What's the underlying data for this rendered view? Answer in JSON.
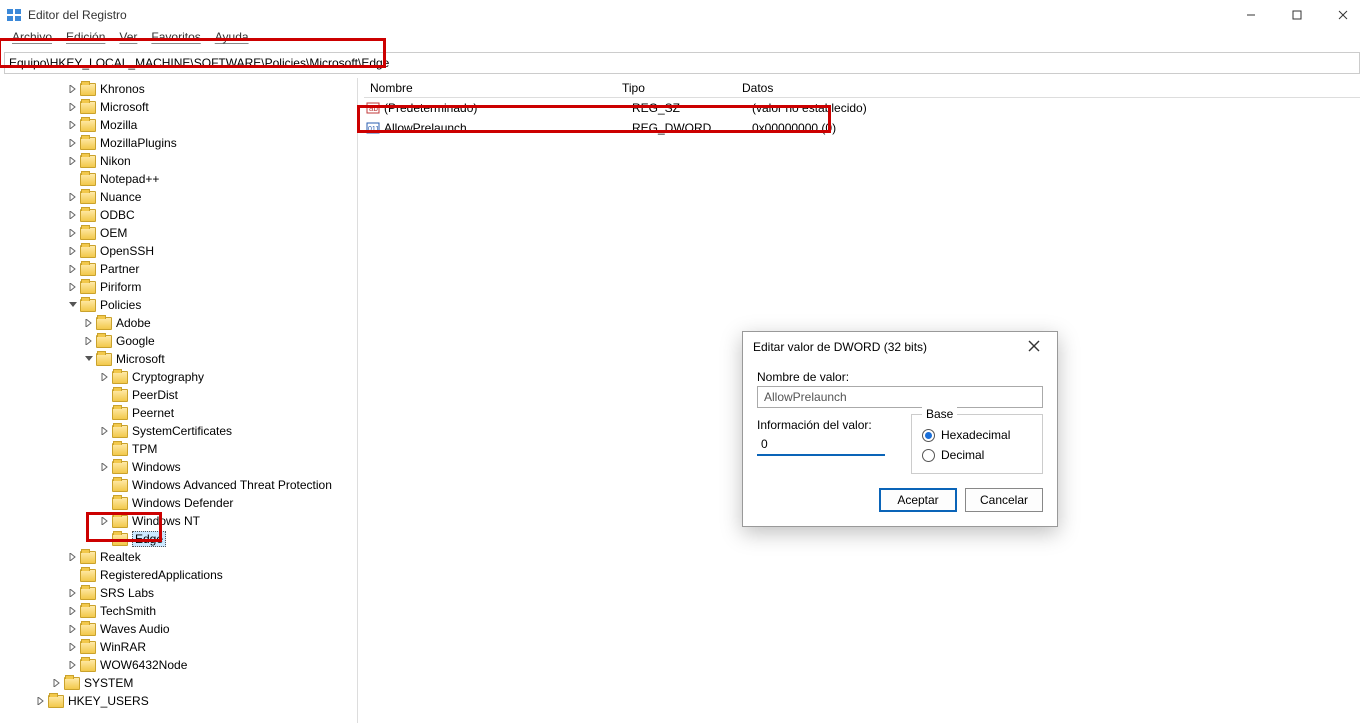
{
  "window": {
    "title": "Editor del Registro"
  },
  "menu": [
    "Archivo",
    "Edición",
    "Ver",
    "Favoritos",
    "Ayuda"
  ],
  "address": "Equipo\\HKEY_LOCAL_MACHINE\\SOFTWARE\\Policies\\Microsoft\\Edge",
  "tree": [
    {
      "depth": 3,
      "arrow": ">",
      "label": "Khronos"
    },
    {
      "depth": 3,
      "arrow": ">",
      "label": "Microsoft"
    },
    {
      "depth": 3,
      "arrow": ">",
      "label": "Mozilla"
    },
    {
      "depth": 3,
      "arrow": ">",
      "label": "MozillaPlugins"
    },
    {
      "depth": 3,
      "arrow": ">",
      "label": "Nikon"
    },
    {
      "depth": 3,
      "arrow": "",
      "label": "Notepad++"
    },
    {
      "depth": 3,
      "arrow": ">",
      "label": "Nuance"
    },
    {
      "depth": 3,
      "arrow": ">",
      "label": "ODBC"
    },
    {
      "depth": 3,
      "arrow": ">",
      "label": "OEM"
    },
    {
      "depth": 3,
      "arrow": ">",
      "label": "OpenSSH"
    },
    {
      "depth": 3,
      "arrow": ">",
      "label": "Partner"
    },
    {
      "depth": 3,
      "arrow": ">",
      "label": "Piriform"
    },
    {
      "depth": 3,
      "arrow": "v",
      "label": "Policies"
    },
    {
      "depth": 4,
      "arrow": ">",
      "label": "Adobe"
    },
    {
      "depth": 4,
      "arrow": ">",
      "label": "Google"
    },
    {
      "depth": 4,
      "arrow": "v",
      "label": "Microsoft"
    },
    {
      "depth": 5,
      "arrow": ">",
      "label": "Cryptography"
    },
    {
      "depth": 5,
      "arrow": "",
      "label": "PeerDist"
    },
    {
      "depth": 5,
      "arrow": "",
      "label": "Peernet"
    },
    {
      "depth": 5,
      "arrow": ">",
      "label": "SystemCertificates"
    },
    {
      "depth": 5,
      "arrow": "",
      "label": "TPM"
    },
    {
      "depth": 5,
      "arrow": ">",
      "label": "Windows"
    },
    {
      "depth": 5,
      "arrow": "",
      "label": "Windows Advanced Threat Protection"
    },
    {
      "depth": 5,
      "arrow": "",
      "label": "Windows Defender"
    },
    {
      "depth": 5,
      "arrow": ">",
      "label": "Windows NT"
    },
    {
      "depth": 5,
      "arrow": "",
      "label": "Edge",
      "selected": true
    },
    {
      "depth": 3,
      "arrow": ">",
      "label": "Realtek"
    },
    {
      "depth": 3,
      "arrow": "",
      "label": "RegisteredApplications"
    },
    {
      "depth": 3,
      "arrow": ">",
      "label": "SRS Labs"
    },
    {
      "depth": 3,
      "arrow": ">",
      "label": "TechSmith"
    },
    {
      "depth": 3,
      "arrow": ">",
      "label": "Waves Audio"
    },
    {
      "depth": 3,
      "arrow": ">",
      "label": "WinRAR"
    },
    {
      "depth": 3,
      "arrow": ">",
      "label": "WOW6432Node"
    },
    {
      "depth": 2,
      "arrow": ">",
      "label": "SYSTEM"
    },
    {
      "depth": 1,
      "arrow": ">",
      "label": "HKEY_USERS"
    }
  ],
  "values": {
    "headers": {
      "name": "Nombre",
      "type": "Tipo",
      "data": "Datos"
    },
    "rows": [
      {
        "icon": "str",
        "name": "(Predeterminado)",
        "type": "REG_SZ",
        "data": "(valor no establecido)"
      },
      {
        "icon": "dword",
        "name": "AllowPrelaunch",
        "type": "REG_DWORD",
        "data": "0x00000000 (0)"
      }
    ]
  },
  "dialog": {
    "title": "Editar valor de DWORD (32 bits)",
    "nameLabel": "Nombre de valor:",
    "nameValue": "AllowPrelaunch",
    "dataLabel": "Información del valor:",
    "dataValue": "0",
    "baseLabel": "Base",
    "hex": "Hexadecimal",
    "dec": "Decimal",
    "ok": "Aceptar",
    "cancel": "Cancelar"
  }
}
